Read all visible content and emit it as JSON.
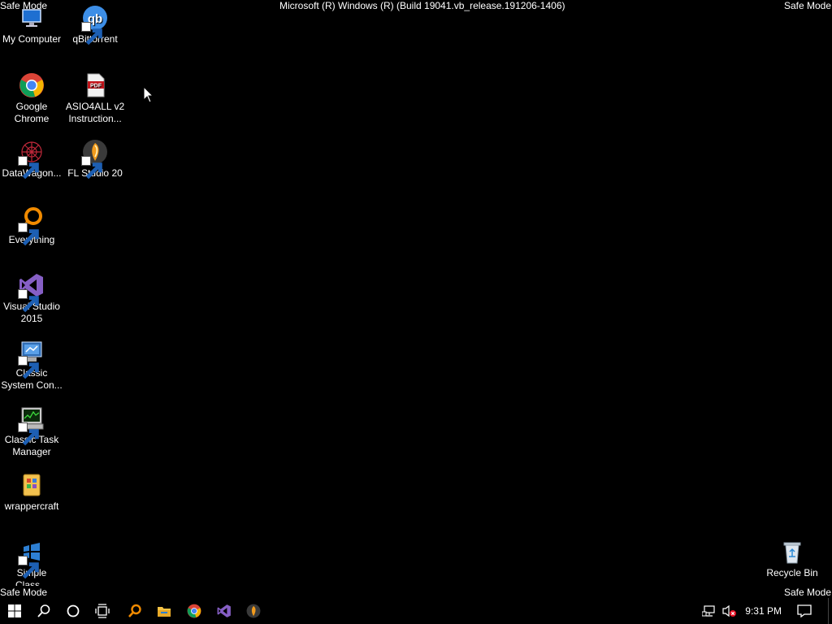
{
  "watermark": {
    "safe_mode": "Safe Mode",
    "build": "Microsoft (R) Windows (R) (Build 19041.vb_release.191206-1406)"
  },
  "desktop_icons": [
    {
      "label": "My Computer"
    },
    {
      "label": "qBittorrent"
    },
    {
      "label": "Google Chrome"
    },
    {
      "label": "ASIO4ALL v2 Instruction..."
    },
    {
      "label": "DataWagon..."
    },
    {
      "label": "FL Studio 20"
    },
    {
      "label": "Everything"
    },
    {
      "label": "Visual Studio 2015"
    },
    {
      "label": "Classic System Con..."
    },
    {
      "label": "Classic Task Manager"
    },
    {
      "label": "wrappercraft"
    },
    {
      "label": "Simple Class..."
    },
    {
      "label": "Recycle Bin"
    }
  ],
  "taskbar": {
    "clock": "9:31 PM",
    "icons": [
      "windows-start-icon",
      "search-icon",
      "cortana-icon",
      "task-view-icon",
      "everything-search-icon",
      "file-explorer-icon",
      "chrome-icon",
      "visual-studio-icon",
      "fl-studio-icon"
    ]
  },
  "colors": {
    "background": "#000000",
    "text": "#ffffff",
    "vs_purple": "#865fc5",
    "everything_orange": "#f08a00"
  }
}
